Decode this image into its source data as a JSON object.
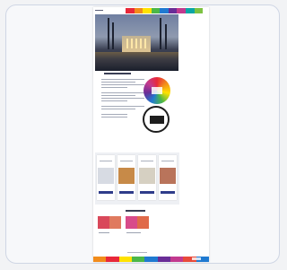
{
  "page": {
    "background": "#f2f3f5",
    "frame_border_color": "#cfd6e4"
  },
  "thumbnail": {
    "header": {
      "logo_icon": "logo-icon",
      "rainbow_colors": [
        "#e8283a",
        "#f28c1b",
        "#ffe200",
        "#4cb748",
        "#1f7ad1",
        "#6a2d97",
        "#c23a8f",
        "#0aa6a6",
        "#7dc242"
      ]
    },
    "hero": {
      "image_icon": "building-at-dusk-photo-icon"
    },
    "badges": {
      "pride_icon": "rainbow-circle-badge-icon",
      "stamp_icon": "circular-stamp-seal-icon"
    },
    "products": {
      "count": 4,
      "button_color": "#2f3c8a",
      "items": [
        {
          "image_icon": "product-image-icon",
          "tone": "#d9dce4"
        },
        {
          "image_icon": "wooden-object-product-icon",
          "tone": "#c78a48"
        },
        {
          "image_icon": "stand-product-icon",
          "tone": "#d6d0c2"
        },
        {
          "image_icon": "hand-product-icon",
          "tone": "#b9745b"
        }
      ]
    },
    "gallery": {
      "images": [
        {
          "icon": "gallery-image-icon",
          "color": "#d9485a"
        },
        {
          "icon": "gallery-image-icon",
          "color": "#e07a5f"
        },
        {
          "icon": "gallery-image-icon",
          "color": "#d84b8a"
        },
        {
          "icon": "gallery-image-icon",
          "color": "#e06a4a"
        }
      ]
    },
    "footer": {
      "rainbow_colors": [
        "#f28c1b",
        "#e8283a",
        "#ffe200",
        "#4cb748",
        "#1f7ad1",
        "#6a2d97",
        "#c23a8f",
        "#e84a3a",
        "#1f7ad1"
      ]
    }
  }
}
